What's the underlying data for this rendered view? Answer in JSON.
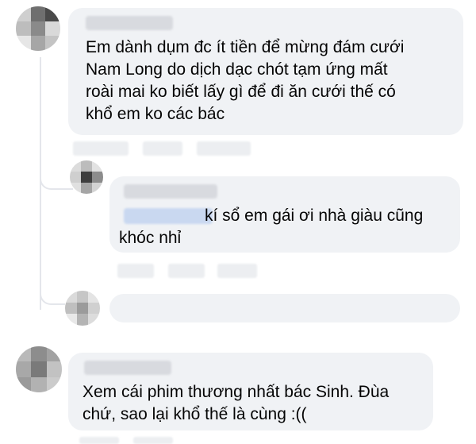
{
  "comments": [
    {
      "id": "c1",
      "text_lines": [
        "Em dành dụm đc ít tiền để mừng đám cưới",
        "Nam Long  do dịch dạc chót tạm ứng mất",
        "roài mai ko biết lấy gì để đi ăn cưới  thế có",
        "khổ em ko các bác"
      ]
    },
    {
      "id": "c2",
      "text_lines": [
        "kí sổ em gái ơi nhà giàu cũng",
        "khóc nhỉ"
      ]
    },
    {
      "id": "c3",
      "text_lines": [
        "Xem cái phim thương nhất bác Sinh. Đùa",
        "chứ, sao lại khổ thế là cùng :(("
      ]
    }
  ],
  "colors": {
    "bubble": "#f0f2f5",
    "text": "#050505",
    "thread_line": "#e4e6eb",
    "blurred_name": "#d8dadf",
    "tag_highlight": "#c9d8f0"
  }
}
